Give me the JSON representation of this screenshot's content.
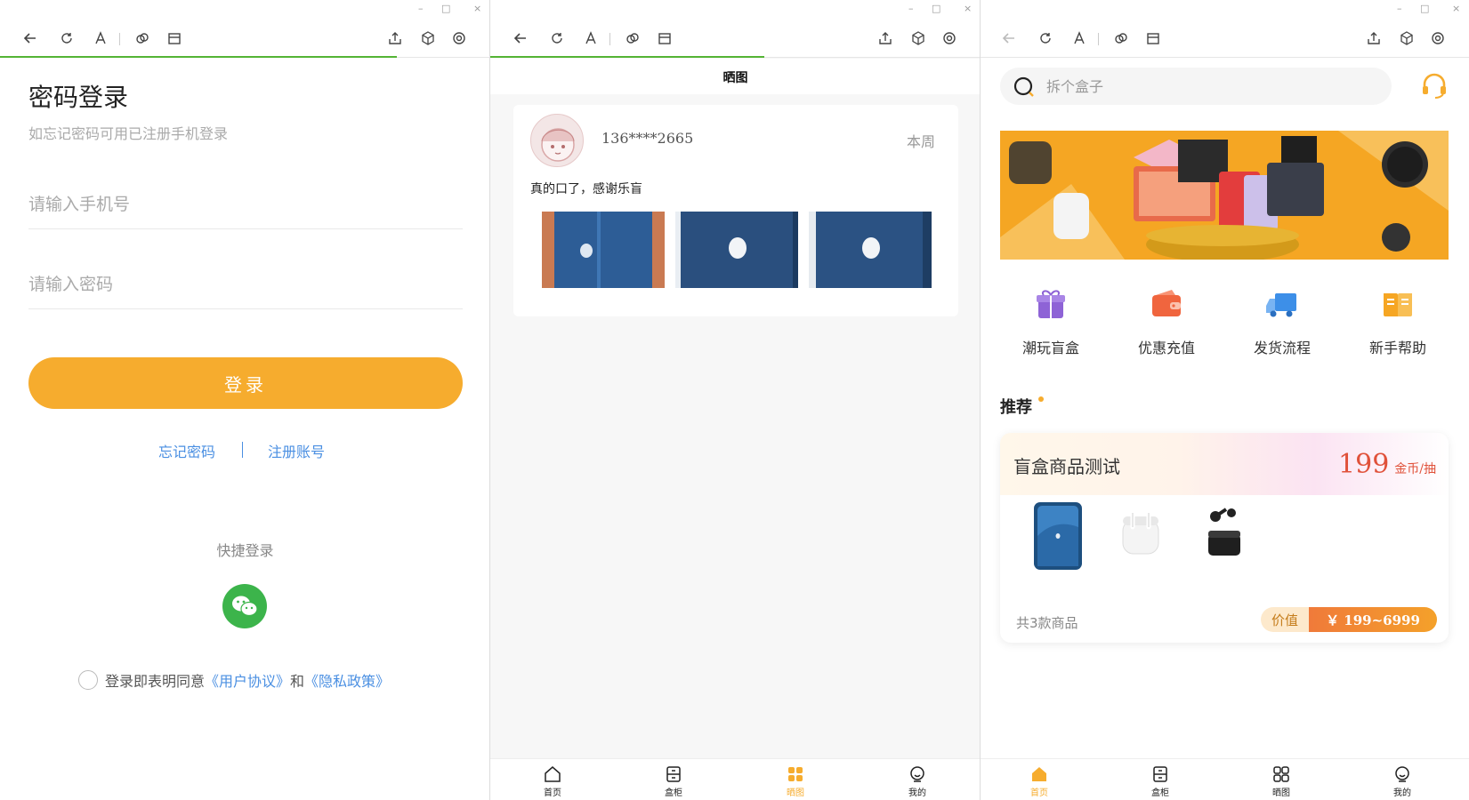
{
  "windows": {
    "controls": {
      "minimize": "–",
      "maximize": "□",
      "close": "×"
    },
    "toolbar_icons": [
      "back-icon",
      "refresh-icon",
      "text-icon",
      "link-icon",
      "calendar-icon",
      "share-icon",
      "cube-icon",
      "target-icon"
    ]
  },
  "login": {
    "title": "密码登录",
    "subtitle": "如忘记密码可用已注册手机登录",
    "phone_placeholder": "请输入手机号",
    "password_placeholder": "请输入密码",
    "login_button": "登录",
    "forgot_link": "忘记密码",
    "register_link": "注册账号",
    "quick_login": "快捷登录",
    "agreement": {
      "prefix": "登录即表明同意",
      "user_agreement": "《用户协议》",
      "and": "和",
      "privacy": "《隐私政策》"
    }
  },
  "showcase": {
    "title": "晒图",
    "post": {
      "user": "136****2665",
      "time": "本周",
      "text": "真的口了，感谢乐盲"
    }
  },
  "home": {
    "search_placeholder": "拆个盒子",
    "categories": [
      {
        "label": "潮玩盲盒",
        "icon": "gift-box-icon",
        "color": "#8e63d6"
      },
      {
        "label": "优惠充值",
        "icon": "wallet-icon",
        "color": "#f0653e"
      },
      {
        "label": "发货流程",
        "icon": "truck-icon",
        "color": "#3d8fe8"
      },
      {
        "label": "新手帮助",
        "icon": "book-icon",
        "color": "#f6a623"
      }
    ],
    "recommend_title": "推荐",
    "product": {
      "name": "盲盒商品测试",
      "price": "199",
      "price_unit": "金币/抽",
      "count": "共3款商品",
      "value_label": "价值",
      "value_range": "￥ 199~6999"
    }
  },
  "tabs": [
    {
      "label": "首页",
      "icon": "home-icon"
    },
    {
      "label": "盒柜",
      "icon": "cabinet-icon"
    },
    {
      "label": "晒图",
      "icon": "grid-icon"
    },
    {
      "label": "我的",
      "icon": "profile-icon"
    }
  ],
  "colors": {
    "accent": "#f6ac2e",
    "link": "#4a8fe2",
    "progress": "#54b435",
    "wechat": "#3cb44b",
    "price": "#e0513a"
  }
}
